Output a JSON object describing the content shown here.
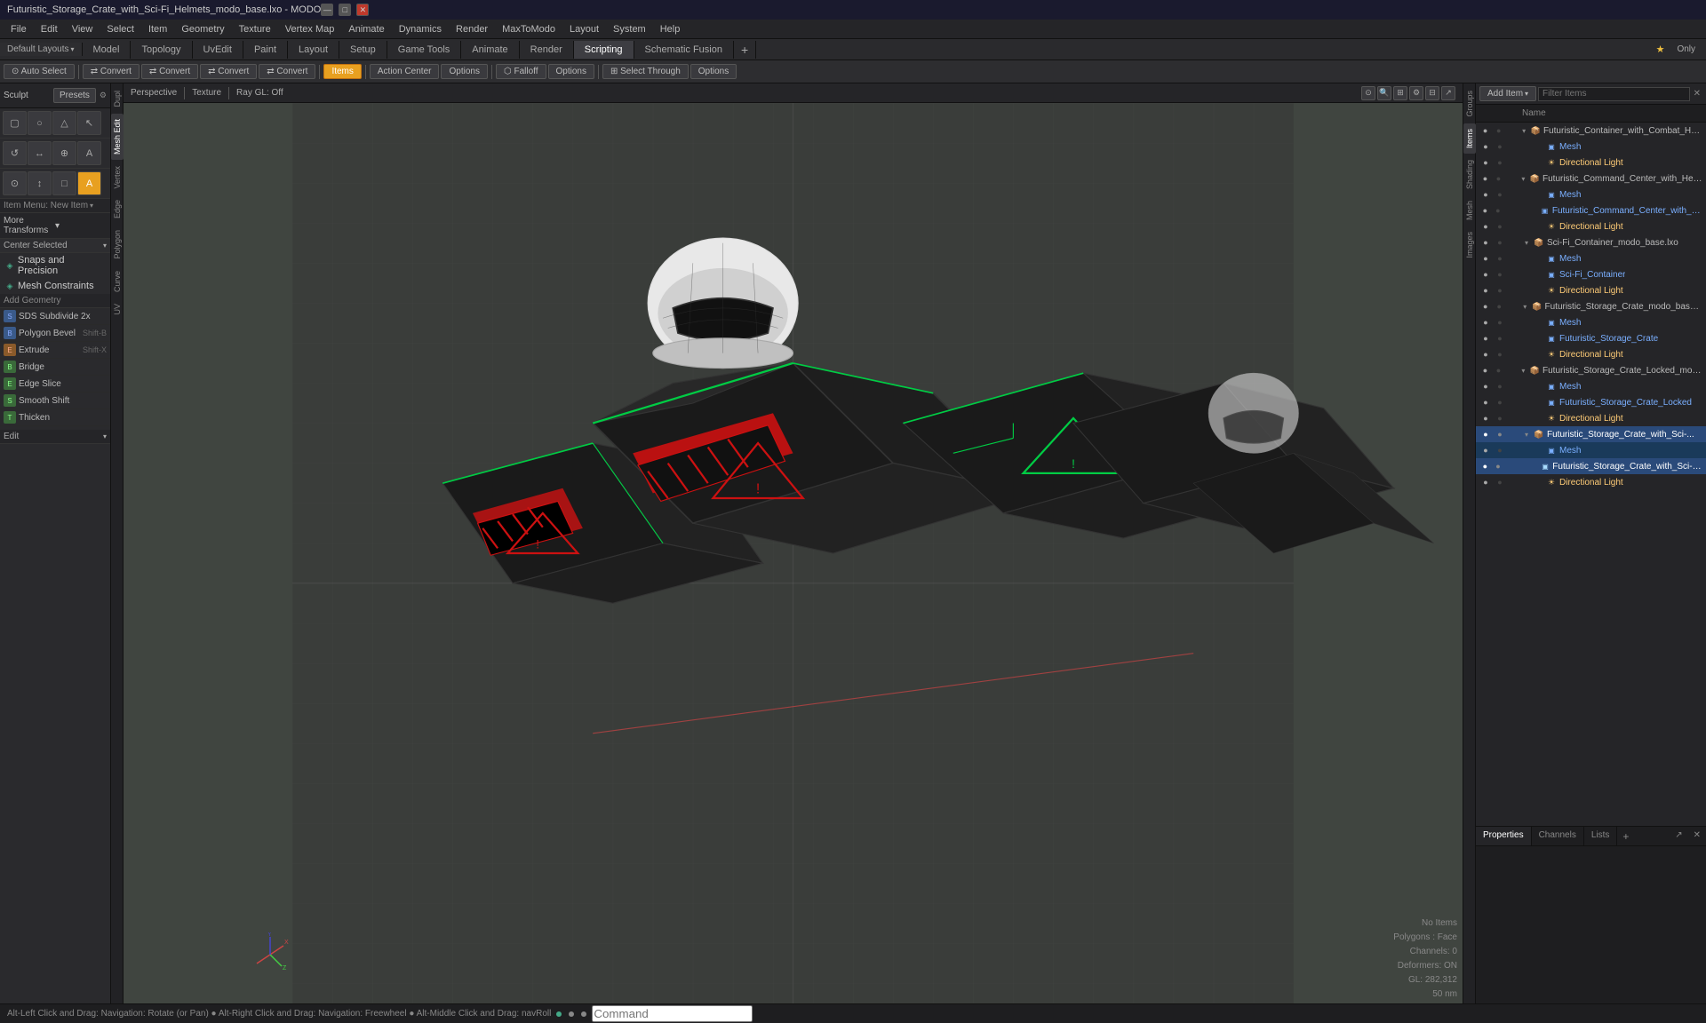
{
  "titlebar": {
    "title": "Futuristic_Storage_Crate_with_Sci-Fi_Helmets_modo_base.lxo - MODO",
    "min": "—",
    "max": "□",
    "close": "✕"
  },
  "menubar": {
    "items": [
      "File",
      "Edit",
      "View",
      "Select",
      "Item",
      "Geometry",
      "Texture",
      "Vertex Map",
      "Animate",
      "Dynamics",
      "Render",
      "MaxToModo",
      "Layout",
      "System",
      "Help"
    ]
  },
  "maintabs": {
    "tabs": [
      "Model",
      "Topology",
      "UvEdit",
      "Paint",
      "Layout",
      "Setup",
      "Game Tools",
      "Animate",
      "Render",
      "Scripting",
      "Schematic Fusion"
    ],
    "active": "Model",
    "right": {
      "star": "★",
      "only": "Only"
    }
  },
  "toolbar": {
    "buttons": [
      {
        "label": "Auto Select",
        "icon": "⊙",
        "active": false
      },
      {
        "label": "Convert",
        "icon": "⇄",
        "active": false
      },
      {
        "label": "Convert",
        "icon": "⇄",
        "active": false
      },
      {
        "label": "Convert",
        "icon": "⇄",
        "active": false
      },
      {
        "label": "Convert",
        "icon": "⇄",
        "active": false
      },
      {
        "label": "Items",
        "active": true
      },
      {
        "label": "Action Center",
        "active": false
      },
      {
        "label": "Options",
        "active": false
      },
      {
        "label": "Falloff",
        "active": false
      },
      {
        "label": "Options",
        "active": false
      },
      {
        "label": "Select Through",
        "active": false
      },
      {
        "label": "Options",
        "active": false
      }
    ]
  },
  "sculpt": {
    "label": "Sculpt",
    "presets": "Presets"
  },
  "tool_icons_row1": [
    "🔲",
    "○",
    "□",
    "△"
  ],
  "tool_icons_row2": [
    "↺",
    "↔",
    "⊕",
    "A"
  ],
  "tool_icons_row3": [
    "⊙",
    "↕",
    "□",
    "A"
  ],
  "transforms": {
    "label": "More Transforms",
    "arrow": "▾"
  },
  "center_selected": {
    "label": "Center Selected",
    "arrow": "▾"
  },
  "snaps": {
    "precision_label": "Snaps and Precision",
    "mesh_constraints_label": "Mesh Constraints",
    "precision_icon": "◈",
    "mesh_icon": "◈"
  },
  "add_geometry": {
    "label": "Add Geometry"
  },
  "geometry_tools": [
    {
      "label": "SDS Subdivide 2x",
      "shortcut": "",
      "icon_color": "blue"
    },
    {
      "label": "Polygon Bevel",
      "shortcut": "Shift-B",
      "icon_color": "blue"
    },
    {
      "label": "Extrude",
      "shortcut": "Shift-X",
      "icon_color": "orange"
    },
    {
      "label": "Bridge",
      "shortcut": "",
      "icon_color": "green"
    },
    {
      "label": "Edge Slice",
      "shortcut": "",
      "icon_color": "green"
    },
    {
      "label": "Smooth Shift",
      "shortcut": "",
      "icon_color": "green"
    },
    {
      "label": "Thicken",
      "shortcut": "",
      "icon_color": "green"
    }
  ],
  "edit_dropdown": {
    "label": "Edit",
    "arrow": "▾"
  },
  "viewport": {
    "projection": "Perspective",
    "texture": "Texture",
    "raygl": "Ray GL: Off",
    "status_items": "No Items",
    "polygons": "Polygons : Face",
    "channels": "Channels: 0",
    "deformers": "Deformers: ON",
    "gl_coords": "GL: 282,312",
    "gl_size": "50 nm"
  },
  "vtabs_center": [
    "Dupl",
    "Mesh Edit",
    "Vertex",
    "Edge",
    "Polygon",
    "Curve",
    "UV"
  ],
  "vtabs_right": [
    "Groups",
    "Items",
    "Shading",
    "Mesh",
    "Images"
  ],
  "items_panel": {
    "add_item": "Add Item",
    "add_item_arrow": "▾",
    "filter_placeholder": "Filter Items",
    "col_name": "Name",
    "items": [
      {
        "name": "Mesh",
        "type": "mesh",
        "indent": 28,
        "expand": false,
        "visible": true
      },
      {
        "name": "Futuristic_Container_with_Combat_Helm...",
        "type": "container",
        "indent": 14,
        "expand": true,
        "visible": true
      },
      {
        "name": "Directional Light",
        "type": "light",
        "indent": 28,
        "expand": false,
        "visible": true
      },
      {
        "name": "Futuristic_Command_Center_with_Helmet ...",
        "type": "container",
        "indent": 14,
        "expand": true,
        "visible": true
      },
      {
        "name": "Mesh",
        "type": "mesh",
        "indent": 28,
        "expand": false,
        "visible": true
      },
      {
        "name": "Futuristic_Command_Center_with_Helm...",
        "type": "mesh",
        "indent": 28,
        "expand": false,
        "visible": true
      },
      {
        "name": "Directional Light",
        "type": "light",
        "indent": 28,
        "expand": false,
        "visible": true
      },
      {
        "name": "Sci-Fi_Container_modo_base.lxo",
        "type": "container",
        "indent": 14,
        "expand": true,
        "visible": true
      },
      {
        "name": "Mesh",
        "type": "mesh",
        "indent": 28,
        "expand": false,
        "visible": true
      },
      {
        "name": "Sci-Fi_Container",
        "type": "mesh",
        "indent": 28,
        "expand": false,
        "visible": true
      },
      {
        "name": "Directional Light",
        "type": "light",
        "indent": 28,
        "expand": false,
        "visible": true
      },
      {
        "name": "Futuristic_Storage_Crate_modo_base.lxo",
        "type": "container",
        "indent": 14,
        "expand": true,
        "visible": true
      },
      {
        "name": "Mesh",
        "type": "mesh",
        "indent": 28,
        "expand": false,
        "visible": true
      },
      {
        "name": "Futuristic_Storage_Crate",
        "type": "mesh",
        "indent": 28,
        "expand": false,
        "visible": true
      },
      {
        "name": "Directional Light",
        "type": "light",
        "indent": 28,
        "expand": false,
        "visible": true
      },
      {
        "name": "Futuristic_Storage_Crate_Locked_modo_b...",
        "type": "container",
        "indent": 14,
        "expand": true,
        "visible": true
      },
      {
        "name": "Mesh",
        "type": "mesh",
        "indent": 28,
        "expand": false,
        "visible": true
      },
      {
        "name": "Futuristic_Storage_Crate_Locked",
        "type": "mesh",
        "indent": 28,
        "expand": false,
        "visible": true
      },
      {
        "name": "Directional Light",
        "type": "light",
        "indent": 28,
        "expand": false,
        "visible": true
      },
      {
        "name": "Futuristic_Storage_Crate_with_Sci-...",
        "type": "container",
        "indent": 14,
        "expand": true,
        "visible": true,
        "selected": true
      },
      {
        "name": "Mesh",
        "type": "mesh",
        "indent": 28,
        "expand": false,
        "visible": true
      },
      {
        "name": "Futuristic_Storage_Crate_with_Sci-Fi_H...",
        "type": "mesh",
        "indent": 28,
        "expand": false,
        "visible": true,
        "selected": true
      },
      {
        "name": "Directional Light",
        "type": "light",
        "indent": 28,
        "expand": false,
        "visible": true
      }
    ]
  },
  "properties_panel": {
    "tabs": [
      "Properties",
      "Channels",
      "Lists"
    ],
    "plus": "+"
  },
  "statusbar": {
    "text": "Alt-Left Click and Drag: Navigation: Rotate (or Pan)  ●  Alt-Right Click and Drag: Navigation: Freewheel  ●  Alt-Middle Click and Drag: navRoll",
    "command_placeholder": "Command"
  },
  "colors": {
    "active_tab_bg": "#e8a020",
    "selected_item_bg": "#2a4a7a",
    "mesh_color": "#7aafff",
    "light_color": "#ffcc77",
    "highlight_bg": "#1a3a5a"
  }
}
